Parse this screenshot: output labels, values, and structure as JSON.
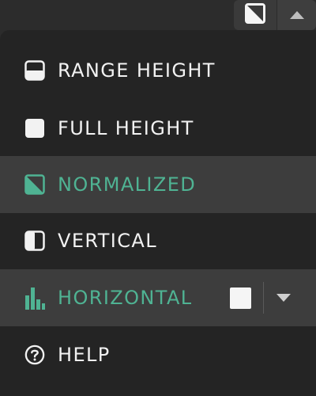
{
  "colors": {
    "background": "#242424",
    "highlight": "#3d3d3d",
    "text": "#f2f2f2",
    "accent": "#4fb393"
  },
  "topbar": {
    "view_button_icon": "normalized-icon",
    "toggle_button_icon": "caret-up-icon"
  },
  "menu": {
    "items": [
      {
        "label": "RANGE HEIGHT",
        "icon": "range-height-icon"
      },
      {
        "label": "FULL HEIGHT",
        "icon": "full-height-icon"
      },
      {
        "label": "NORMALIZED",
        "icon": "normalized-icon",
        "selected": true
      },
      {
        "label": "VERTICAL",
        "icon": "vertical-icon"
      },
      {
        "label": "HORIZONTAL",
        "icon": "bar-chart-icon",
        "selected": true,
        "swatch_color": "#f5f5f5",
        "dropdown_icon": "caret-down-icon"
      },
      {
        "label": "HELP",
        "icon": "help-circle-icon"
      }
    ]
  }
}
